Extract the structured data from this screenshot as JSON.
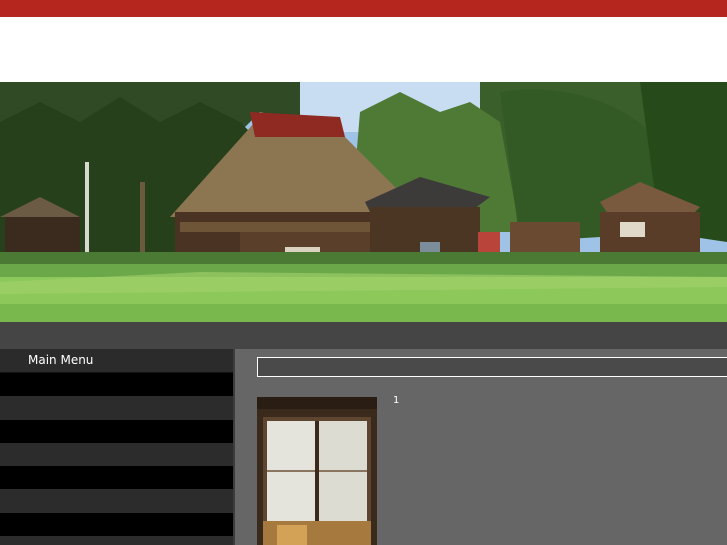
{
  "topbar": {
    "text": ""
  },
  "site": {
    "title": ""
  },
  "hero": {
    "alt": ""
  },
  "breadcrumb": {
    "text": ""
  },
  "sidebar": {
    "title": "Main Menu",
    "items": [
      {
        "label": ""
      },
      {
        "label": ""
      },
      {
        "label": ""
      },
      {
        "label": ""
      },
      {
        "label": ""
      },
      {
        "label": ""
      },
      {
        "label": ""
      },
      {
        "label": ""
      }
    ]
  },
  "main": {
    "section_title": "",
    "paragraph1": "1",
    "paragraph2": ""
  },
  "colors": {
    "topbar": "#b5261e",
    "breadcrumb": "#454545",
    "sidebar": "#1a1a1a",
    "main": "#666666"
  }
}
